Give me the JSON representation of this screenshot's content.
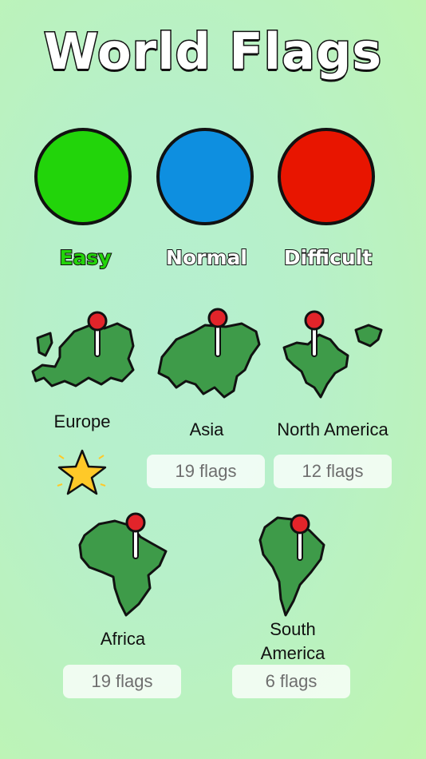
{
  "title": "World Flags",
  "difficulty": [
    {
      "label": "Easy",
      "color": "#22d40a",
      "label_color": "#22d40a",
      "selected": true
    },
    {
      "label": "Normal",
      "color": "#0e8fe0",
      "label_color": "#ffffff",
      "selected": false
    },
    {
      "label": "Difficult",
      "color": "#e81500",
      "label_color": "#ffffff",
      "selected": false
    }
  ],
  "continents": [
    {
      "name": "Europe",
      "flags": null,
      "completed": true,
      "icon": "europe-map-icon"
    },
    {
      "name": "Asia",
      "flags": "19 flags",
      "icon": "asia-map-icon"
    },
    {
      "name": "North America",
      "flags": "12 flags",
      "icon": "north-america-map-icon"
    },
    {
      "name": "Africa",
      "flags": "19 flags",
      "icon": "africa-map-icon"
    },
    {
      "name": "South\nAmerica",
      "flags": "6 flags",
      "icon": "south-america-map-icon"
    }
  ],
  "colors": {
    "map_green": "#3e9b49",
    "pin_red": "#e2242a",
    "star_yellow": "#ffc928"
  }
}
